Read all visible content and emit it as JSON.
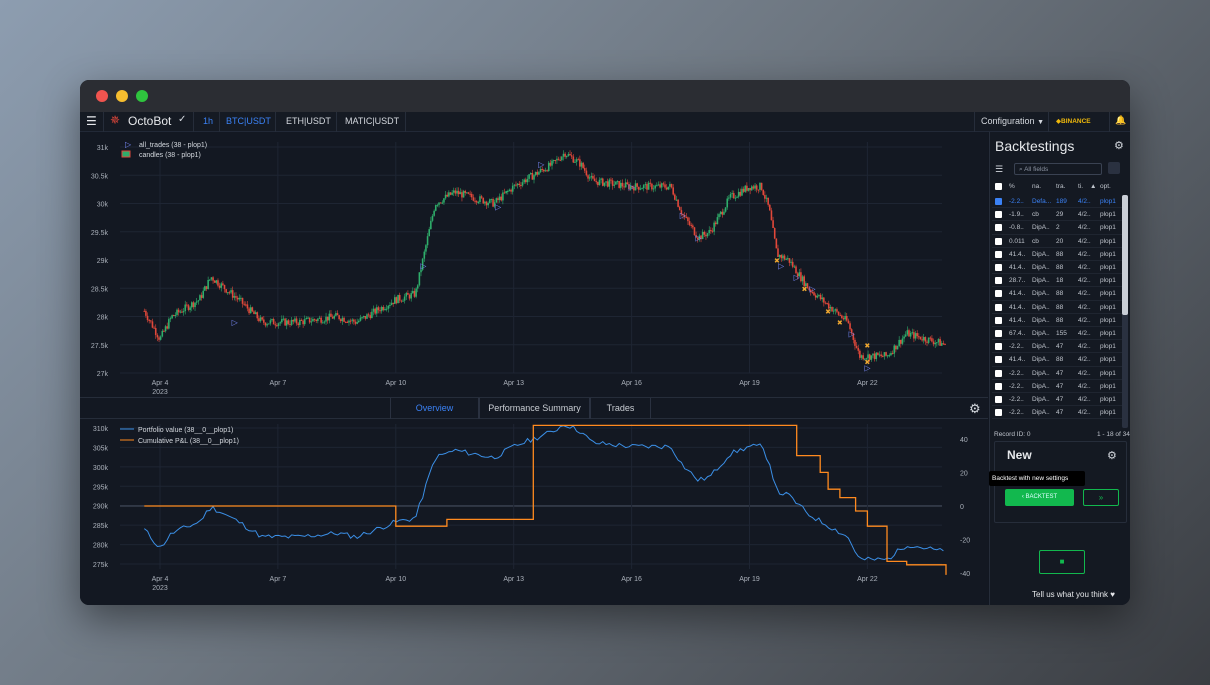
{
  "app": {
    "name": "OctoBot",
    "timeframe": "1h",
    "pairs": [
      "BTC|USDT",
      "ETH|USDT",
      "MATIC|USDT"
    ],
    "configuration_label": "Configuration",
    "exchange_label": "BINANCE"
  },
  "colors": {
    "accent": "#1f6feb",
    "up": "#2fae6b",
    "down": "#e2483a",
    "pnl": "#ff8a1f",
    "portfolio": "#3b8fe6",
    "green_btn": "#12b84e"
  },
  "tabs": [
    "Overview",
    "Performance Summary",
    "Trades"
  ],
  "chart_data": [
    {
      "type": "candlestick",
      "legend": [
        "all_trades (38 - plop1)",
        "candles (38 - plop1)"
      ],
      "y_ticks": [
        "31k",
        "30.5k",
        "30k",
        "29.5k",
        "29k",
        "28.5k",
        "28k",
        "27.5k",
        "27k"
      ],
      "x_ticks": [
        "Apr 4",
        "Apr 7",
        "Apr 10",
        "Apr 13",
        "Apr 16",
        "Apr 19",
        "Apr 22"
      ],
      "x_sub": "2023",
      "ylim": [
        27000,
        31200
      ],
      "close_path": [
        [
          "Apr 3.6",
          28100
        ],
        [
          "Apr 4",
          27600
        ],
        [
          "Apr 4.3",
          28000
        ],
        [
          "Apr 5",
          28300
        ],
        [
          "Apr 5.3",
          28700
        ],
        [
          "Apr 6",
          28300
        ],
        [
          "Apr 6.6",
          27900
        ],
        [
          "Apr 7.5",
          27900
        ],
        [
          "Apr 8.5",
          28000
        ],
        [
          "Apr 9",
          27900
        ],
        [
          "Apr 9.5",
          28100
        ],
        [
          "Apr 10",
          28300
        ],
        [
          "Apr 10.5",
          28400
        ],
        [
          "Apr 11",
          30000
        ],
        [
          "Apr 11.5",
          30200
        ],
        [
          "Apr 12",
          30100
        ],
        [
          "Apr 12.5",
          30000
        ],
        [
          "Apr 13",
          30300
        ],
        [
          "Apr 13.5",
          30500
        ],
        [
          "Apr 14",
          30700
        ],
        [
          "Apr 14.3",
          30900
        ],
        [
          "Apr 14.7",
          30700
        ],
        [
          "Apr 15",
          30400
        ],
        [
          "Apr 16",
          30300
        ],
        [
          "Apr 17",
          30300
        ],
        [
          "Apr 17.3",
          29800
        ],
        [
          "Apr 17.7",
          29400
        ],
        [
          "Apr 18",
          29500
        ],
        [
          "Apr 18.5",
          30100
        ],
        [
          "Apr 19",
          30300
        ],
        [
          "Apr 19.3",
          30300
        ],
        [
          "Apr 19.5",
          29900
        ],
        [
          "Apr 19.7",
          29100
        ],
        [
          "Apr 20",
          29000
        ],
        [
          "Apr 20.5",
          28500
        ],
        [
          "Apr 21",
          28200
        ],
        [
          "Apr 21.5",
          27900
        ],
        [
          "Apr 21.8",
          27300
        ],
        [
          "Apr 22",
          27300
        ],
        [
          "Apr 22.5",
          27300
        ],
        [
          "Apr 23",
          27700
        ],
        [
          "Apr 23.5",
          27600
        ],
        [
          "Apr 24",
          27500
        ]
      ]
    },
    {
      "type": "line",
      "series": [
        {
          "name": "Portfolio value (38__0__plop1)",
          "axis": "left"
        },
        {
          "name": "Cumulative P&L (38__0__plop1)",
          "axis": "right"
        }
      ],
      "y_ticks_left": [
        "310k",
        "305k",
        "300k",
        "295k",
        "290k",
        "285k",
        "280k",
        "275k"
      ],
      "y_ticks_right": [
        "40",
        "20",
        "0",
        "-20",
        "-40"
      ],
      "x_ticks": [
        "Apr 4",
        "Apr 7",
        "Apr 10",
        "Apr 13",
        "Apr 16",
        "Apr 19",
        "Apr 22"
      ],
      "x_sub": "2023",
      "ylim_left": [
        272500,
        311000
      ],
      "ylim_right": [
        -41,
        50
      ],
      "pnl_steps": [
        [
          "Apr 3.6",
          0
        ],
        [
          "Apr 10",
          0
        ],
        [
          "Apr 10",
          -12
        ],
        [
          "Apr 11.3",
          -12
        ],
        [
          "Apr 11.3",
          -8
        ],
        [
          "Apr 13.5",
          -8
        ],
        [
          "Apr 13.5",
          48
        ],
        [
          "Apr 20.2",
          48
        ],
        [
          "Apr 20.2",
          30
        ],
        [
          "Apr 20.8",
          30
        ],
        [
          "Apr 20.8",
          20
        ],
        [
          "Apr 21",
          20
        ],
        [
          "Apr 21",
          10
        ],
        [
          "Apr 21.3",
          10
        ],
        [
          "Apr 21.3",
          5
        ],
        [
          "Apr 21.7",
          5
        ],
        [
          "Apr 21.7",
          -3
        ],
        [
          "Apr 22",
          -3
        ],
        [
          "Apr 22",
          -12
        ],
        [
          "Apr 22.5",
          -12
        ],
        [
          "Apr 22.5",
          -33
        ],
        [
          "Apr 23",
          -33
        ],
        [
          "Apr 23",
          -35
        ],
        [
          "Apr 24",
          -35
        ],
        [
          "Apr 24",
          -41
        ]
      ]
    }
  ],
  "sidebar": {
    "title": "Backtestings",
    "filter_placeholder": "All fields",
    "columns": [
      "%",
      "na.",
      "tra.",
      "ti.",
      "opt."
    ],
    "rows": [
      [
        "-2.2..",
        "Defa...",
        "189",
        "4/2..",
        "plop1"
      ],
      [
        "-1.9..",
        "cb",
        "29",
        "4/2..",
        "plop1"
      ],
      [
        "-0.8..",
        "DipA..",
        "2",
        "4/2..",
        "plop1"
      ],
      [
        "0.011",
        "cb",
        "20",
        "4/2..",
        "plop1"
      ],
      [
        "41.4..",
        "DipA..",
        "88",
        "4/2..",
        "plop1"
      ],
      [
        "41.4..",
        "DipA..",
        "88",
        "4/2..",
        "plop1"
      ],
      [
        "28.7..",
        "DipA..",
        "18",
        "4/2..",
        "plop1"
      ],
      [
        "41.4..",
        "DipA..",
        "88",
        "4/2..",
        "plop1"
      ],
      [
        "41.4..",
        "DipA..",
        "88",
        "4/2..",
        "plop1"
      ],
      [
        "41.4..",
        "DipA..",
        "88",
        "4/2..",
        "plop1"
      ],
      [
        "67.4..",
        "DipA..",
        "155",
        "4/2..",
        "plop1"
      ],
      [
        "-2.2..",
        "DipA..",
        "47",
        "4/2..",
        "plop1"
      ],
      [
        "41.4..",
        "DipA..",
        "88",
        "4/2..",
        "plop1"
      ],
      [
        "-2.2..",
        "DipA..",
        "47",
        "4/2..",
        "plop1"
      ],
      [
        "-2.2..",
        "DipA..",
        "47",
        "4/2..",
        "plop1"
      ],
      [
        "-2.2..",
        "DipA..",
        "47",
        "4/2..",
        "plop1"
      ],
      [
        "-2.2..",
        "DipA..",
        "47",
        "4/2..",
        "plop1"
      ]
    ],
    "record_id": "Record ID: 0",
    "pagination": "1 - 18 of 34",
    "new_title": "New",
    "tooltip": "Backtest with new settings",
    "backtest_label": "BACKTEST",
    "next_label": "»",
    "feedback": "Tell us what you think"
  }
}
